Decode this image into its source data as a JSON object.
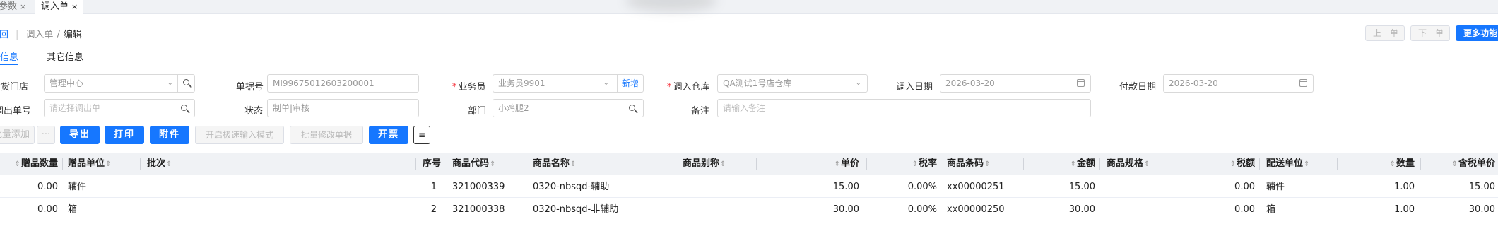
{
  "tabs": [
    {
      "label": "参数",
      "close": "×"
    },
    {
      "label": "调入单",
      "close": "×"
    }
  ],
  "breadcrumb": {
    "back": "返回",
    "parent": "调入单",
    "separator": "/",
    "current": "编辑"
  },
  "nav_buttons": {
    "prev": "上一单",
    "next": "下一单",
    "more": "更多功能"
  },
  "subtabs": {
    "basic": "基本信息",
    "other": "其它信息"
  },
  "form": {
    "ship_store": {
      "label": "发货门店",
      "value": "管理中心"
    },
    "doc_no": {
      "label": "单据号",
      "value": "MI99675012603200001"
    },
    "salesman": {
      "label": "业务员",
      "value": "业务员9901",
      "add_label": "新增"
    },
    "in_warehouse": {
      "label": "调入仓库",
      "value": "QA测试1号店仓库"
    },
    "in_date": {
      "label": "调入日期",
      "value": "2026-03-20"
    },
    "pay_date": {
      "label": "付款日期",
      "value": "2026-03-20"
    },
    "out_doc": {
      "label": "调出单号",
      "placeholder": "请选择调出单"
    },
    "status": {
      "label": "状态",
      "value": "制单|审核"
    },
    "department": {
      "label": "部门",
      "value": "小鸡腿2"
    },
    "remark": {
      "label": "备注",
      "placeholder": "请输入备注"
    }
  },
  "actions": {
    "batch_add": "批量添加",
    "more": "···",
    "export": "导出",
    "print": "打印",
    "attach": "附件",
    "fast_scan": "开启极速输入模式",
    "batch_modify": "批量修改单据",
    "invoice": "开票",
    "columns_icon": "column-settings-icon"
  },
  "table": {
    "columns": {
      "gift_qty": "赠品数量",
      "gift_unit": "赠品单位",
      "batch": "批次",
      "seq": "序号",
      "code": "商品代码",
      "name": "商品名称",
      "alias": "商品别称",
      "price": "单价",
      "tax_rate": "税率",
      "barcode": "商品条码",
      "amount": "金额",
      "spec": "商品规格",
      "tax": "税额",
      "dist_unit": "配送单位",
      "qty": "数量",
      "tax_price": "含税单价"
    },
    "rows": [
      {
        "gift_qty": "0.00",
        "gift_unit": "辅件",
        "batch": "",
        "seq": "1",
        "code": "321000339",
        "name": "0320-nbsqd-辅助",
        "alias": "",
        "price": "15.00",
        "tax_rate": "0.00%",
        "barcode": "xx00000251",
        "amount": "15.00",
        "spec": "",
        "tax": "0.00",
        "dist_unit": "辅件",
        "qty": "1.00",
        "tax_price": "15.00"
      },
      {
        "gift_qty": "0.00",
        "gift_unit": "箱",
        "batch": "",
        "seq": "2",
        "code": "321000338",
        "name": "0320-nbsqd-非辅助",
        "alias": "",
        "price": "30.00",
        "tax_rate": "0.00%",
        "barcode": "xx00000250",
        "amount": "30.00",
        "spec": "",
        "tax": "0.00",
        "dist_unit": "箱",
        "qty": "1.00",
        "tax_price": "30.00"
      }
    ]
  },
  "colors": {
    "accent": "#1677ff",
    "required": "#f5222d",
    "header_bg": "#f0f2f5"
  }
}
